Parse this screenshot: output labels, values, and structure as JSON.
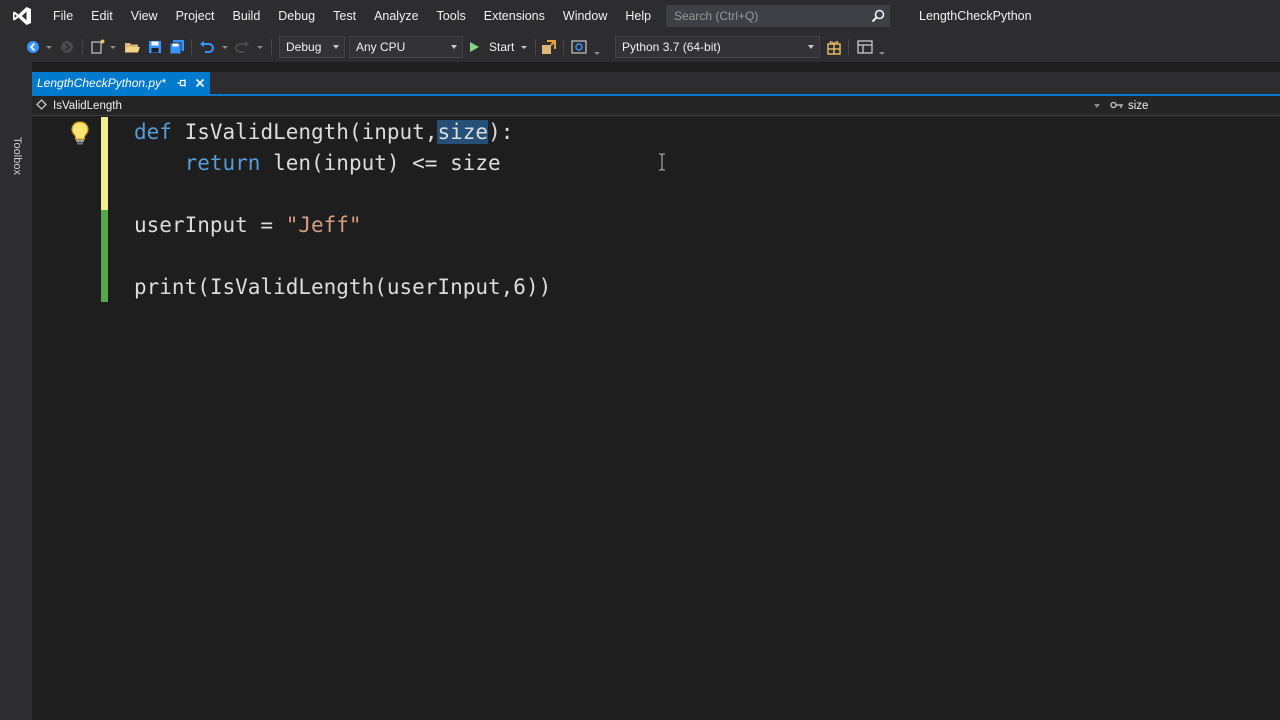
{
  "app": {
    "solution_title": "LengthCheckPython"
  },
  "menu": {
    "items": [
      "File",
      "Edit",
      "View",
      "Project",
      "Build",
      "Debug",
      "Test",
      "Analyze",
      "Tools",
      "Extensions",
      "Window",
      "Help"
    ]
  },
  "search": {
    "placeholder": "Search (Ctrl+Q)"
  },
  "toolbar": {
    "configuration": "Debug",
    "platform": "Any CPU",
    "start_label": "Start",
    "environment": "Python 3.7 (64-bit)"
  },
  "sidebar": {
    "toolbox_label": "Toolbox"
  },
  "document": {
    "tab_label": "LengthCheckPython.py*",
    "nav_member": "IsValidLength",
    "nav_symbol": "size"
  },
  "code": {
    "lines": [
      "def IsValidLength(input,size):",
      "    return len(input) <= size",
      "",
      "userInput = \"Jeff\"",
      "",
      "print(IsValidLength(userInput,6))"
    ]
  },
  "colors": {
    "accent": "#007acc",
    "editor_bg": "#1e1e1e",
    "chrome_bg": "#2d2d30",
    "keyword": "#569cd6",
    "string": "#d69d85",
    "number": "#b5cea8",
    "unsaved_change": "#efef91",
    "saved_change": "#57a64a"
  }
}
